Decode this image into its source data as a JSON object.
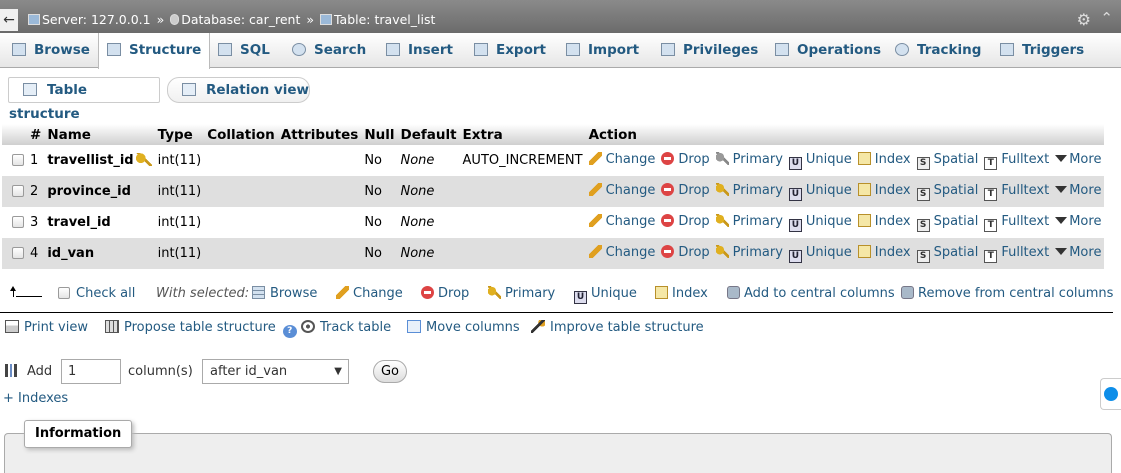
{
  "breadcrumb": {
    "back_arrow": "←",
    "server": "Server: 127.0.0.1",
    "database": "Database: car_rent",
    "table": "Table: travel_list",
    "separator": "»"
  },
  "tabs": [
    {
      "label": "Browse",
      "icon": "browse-icon"
    },
    {
      "label": "Structure",
      "icon": "structure-icon",
      "active": true
    },
    {
      "label": "SQL",
      "icon": "sql-icon"
    },
    {
      "label": "Search",
      "icon": "search-icon"
    },
    {
      "label": "Insert",
      "icon": "insert-icon"
    },
    {
      "label": "Export",
      "icon": "export-icon"
    },
    {
      "label": "Import",
      "icon": "import-icon"
    },
    {
      "label": "Privileges",
      "icon": "privileges-icon"
    },
    {
      "label": "Operations",
      "icon": "operations-icon"
    },
    {
      "label": "Tracking",
      "icon": "tracking-icon"
    },
    {
      "label": "Triggers",
      "icon": "triggers-icon"
    }
  ],
  "subtabs": [
    {
      "label": "Table structure"
    },
    {
      "label": "Relation view"
    }
  ],
  "columns": [
    "#",
    "Name",
    "Type",
    "Collation",
    "Attributes",
    "Null",
    "Default",
    "Extra",
    "Action"
  ],
  "rows": [
    {
      "num": "1",
      "name": "travellist_id",
      "type": "int(11)",
      "collation": "",
      "attributes": "",
      "null": "No",
      "default": "None",
      "extra": "AUTO_INCREMENT",
      "primary_key": true
    },
    {
      "num": "2",
      "name": "province_id",
      "type": "int(11)",
      "collation": "",
      "attributes": "",
      "null": "No",
      "default": "None",
      "extra": ""
    },
    {
      "num": "3",
      "name": "travel_id",
      "type": "int(11)",
      "collation": "",
      "attributes": "",
      "null": "No",
      "default": "None",
      "extra": ""
    },
    {
      "num": "4",
      "name": "id_van",
      "type": "int(11)",
      "collation": "",
      "attributes": "",
      "null": "No",
      "default": "None",
      "extra": ""
    }
  ],
  "row_actions": {
    "change": "Change",
    "drop": "Drop",
    "primary": "Primary",
    "unique": "Unique",
    "index": "Index",
    "spatial": "Spatial",
    "fulltext": "Fulltext",
    "more": "More"
  },
  "bulk": {
    "check_all": "Check all",
    "with_selected": "With selected:",
    "browse": "Browse",
    "change": "Change",
    "drop": "Drop",
    "primary": "Primary",
    "unique": "Unique",
    "index": "Index",
    "add_central": "Add to central columns",
    "remove_central": "Remove from central columns"
  },
  "links": {
    "print_view": "Print view",
    "propose": "Propose table structure",
    "track": "Track table",
    "move": "Move columns",
    "improve": "Improve table structure"
  },
  "add_columns": {
    "add_label": "Add",
    "count": "1",
    "columns_label": "column(s)",
    "position": "after id_van",
    "go": "Go"
  },
  "indexes_toggle": "+ Indexes",
  "information_legend": "Information",
  "icon_glyphs": {
    "unique": "U",
    "spatial": "S",
    "fulltext": "T",
    "help": "?",
    "gear": "⚙",
    "collapse": "⌃",
    "caret": "▼"
  }
}
